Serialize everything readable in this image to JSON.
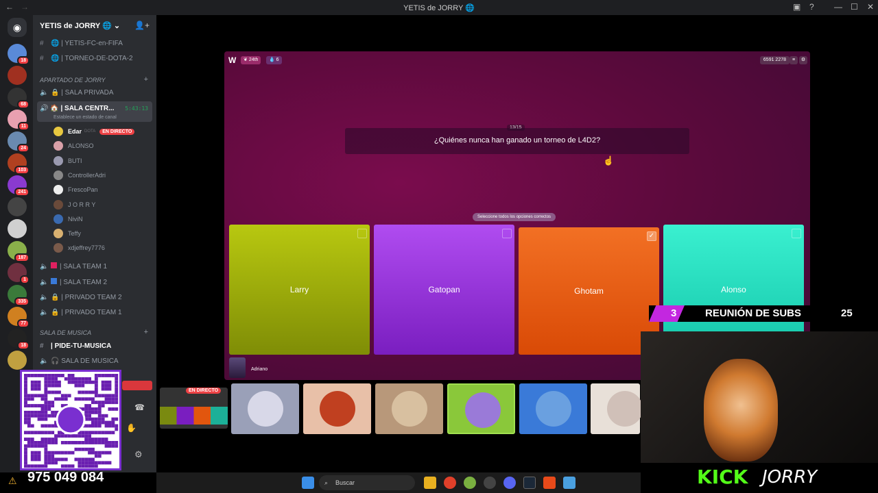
{
  "window": {
    "title": "YETIS de JORRY 🌐"
  },
  "guild": {
    "name": "YETIS de JORRY 🌐 ⌄"
  },
  "channels_top": [
    "| YETIS-FC-en-FIFA",
    "| TORNEO-DE-DOTA-2"
  ],
  "category_1": "APARTADO DE JORRY",
  "voice_channels_1": [
    "| SALA PRIVADA"
  ],
  "active_channel": {
    "name": "| SALA CENTR...",
    "timer": "5:43:13",
    "status": "Establece un estado de canal"
  },
  "members": [
    {
      "name": "Edar",
      "extra": "DOTA",
      "badge": "EN DIRECTO",
      "color": "#e8c840"
    },
    {
      "name": "ALONSO",
      "color": "#d9a0a8"
    },
    {
      "name": "BUTI",
      "color": "#9a9ab0"
    },
    {
      "name": "ControllerAdri",
      "color": "#888"
    },
    {
      "name": "FrescoPan",
      "color": "#eee"
    },
    {
      "name": "J O R R Y",
      "color": "#6a4a3a"
    },
    {
      "name": "NiviN",
      "color": "#3a6ab0"
    },
    {
      "name": "Teffy",
      "color": "#d8b070"
    },
    {
      "name": "xdjeffrey7776",
      "color": "#7a5a4a"
    }
  ],
  "voice_channels_2": [
    "| SALA TEAM 1",
    "| SALA TEAM 2",
    "| PRIVADO TEAM 2",
    "| PRIVADO TEAM 1"
  ],
  "category_2": "SALA DE MUSICA",
  "music_channels": [
    "| PIDE-TU-MUSICA",
    "🎧 SALA DE MUSICA"
  ],
  "server_counts": [
    "18",
    "",
    "68",
    "11",
    "24",
    "103",
    "241",
    "",
    "",
    "187",
    "1",
    "335",
    "77",
    "18",
    ""
  ],
  "game": {
    "rank": "24th",
    "streak": "6",
    "score": "6591 2278",
    "question_count": "13/15",
    "question": "¿Quiénes nunca han ganado un torneo de L4D2?",
    "hint": "Seleccione todos los opciones correctos",
    "options": [
      {
        "label": "Larry",
        "checked": false
      },
      {
        "label": "Gatopan",
        "checked": false
      },
      {
        "label": "Ghotam",
        "checked": true
      },
      {
        "label": "Alonso",
        "checked": false
      }
    ],
    "player": "Adriano"
  },
  "stream_badge": "EN DIRECTO",
  "ticker": {
    "left": "3",
    "message": "REUNIÓN DE SUBS",
    "right": "25"
  },
  "kick": {
    "brand": "KICK",
    "name": "JORRY"
  },
  "phone": "975 049 084",
  "taskbar": {
    "search": "Buscar"
  },
  "colors": {
    "larry": "#a6b60a",
    "gatopan": "#9a2ee0",
    "ghotam": "#f2661a",
    "alonso": "#24e0c4"
  }
}
